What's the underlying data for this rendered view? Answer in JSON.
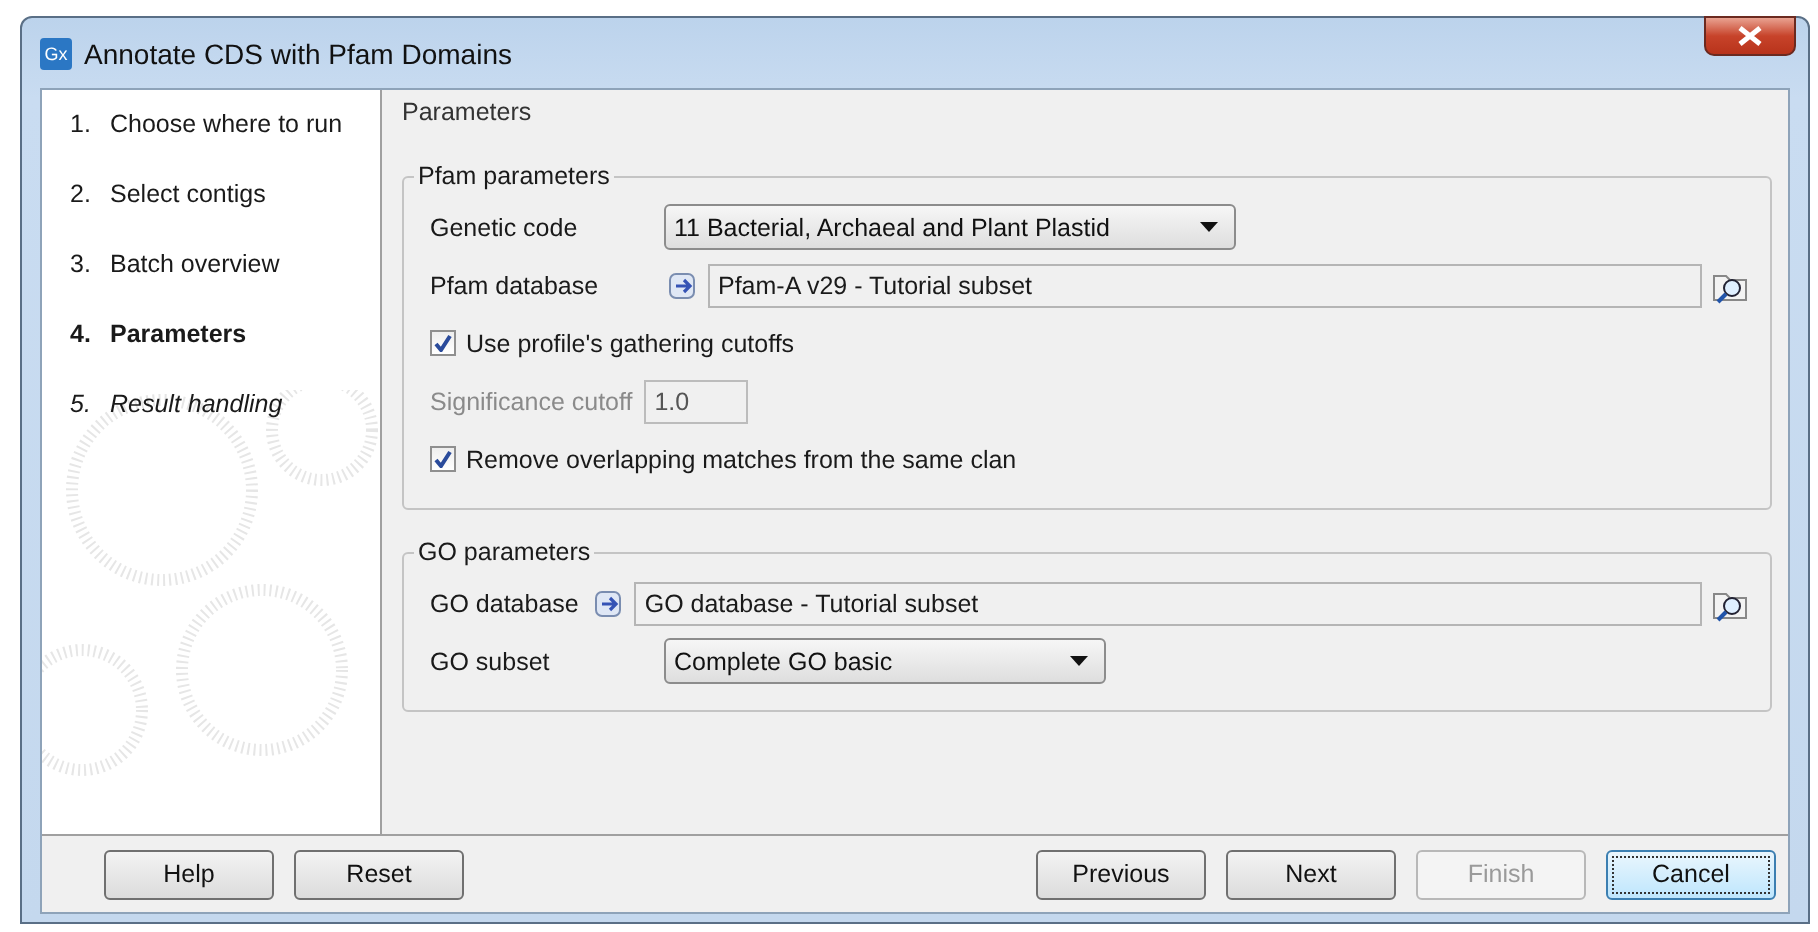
{
  "window": {
    "icon_text": "Gx",
    "title": "Annotate CDS with Pfam Domains"
  },
  "steps": [
    {
      "number": "1.",
      "label": "Choose where to run",
      "selected": false,
      "italic": false
    },
    {
      "number": "2.",
      "label": "Select contigs",
      "selected": false,
      "italic": false
    },
    {
      "number": "3.",
      "label": "Batch overview",
      "selected": false,
      "italic": false
    },
    {
      "number": "4.",
      "label": "Parameters",
      "selected": true,
      "italic": false
    },
    {
      "number": "5.",
      "label": "Result handling",
      "selected": false,
      "italic": true
    }
  ],
  "panel": {
    "title": "Parameters"
  },
  "groups": [
    {
      "title": "Pfam parameters",
      "rows": [
        {
          "kind": "dropdown",
          "label": "Genetic code",
          "value": "11 Bacterial, Archaeal and Plant Plastid"
        },
        {
          "kind": "file",
          "label": "Pfam database",
          "value": "Pfam-A v29 - Tutorial subset"
        },
        {
          "kind": "checkbox",
          "label": "Use profile's gathering cutoffs",
          "checked": true
        },
        {
          "kind": "number",
          "label": "Significance cutoff",
          "value": "1.0",
          "disabled": true
        },
        {
          "kind": "checkbox",
          "label": "Remove overlapping matches from the same clan",
          "checked": true
        }
      ]
    },
    {
      "title": "GO parameters",
      "rows": [
        {
          "kind": "file",
          "label": "GO database",
          "value": "GO database - Tutorial subset"
        },
        {
          "kind": "dropdown",
          "label": "GO subset",
          "value": "Complete GO basic"
        }
      ]
    }
  ],
  "buttons_left": [
    {
      "label": "Help",
      "disabled": false,
      "focused": false
    },
    {
      "label": "Reset",
      "disabled": false,
      "focused": false
    }
  ],
  "buttons_right": [
    {
      "label": "Previous",
      "disabled": false,
      "focused": false
    },
    {
      "label": "Next",
      "disabled": false,
      "focused": false
    },
    {
      "label": "Finish",
      "disabled": true,
      "focused": false
    },
    {
      "label": "Cancel",
      "disabled": false,
      "focused": true
    }
  ]
}
